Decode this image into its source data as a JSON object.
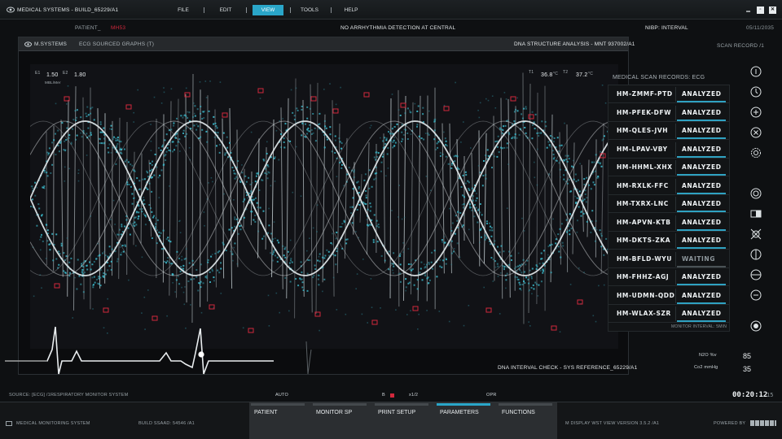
{
  "app": {
    "title": "MEDICAL SYSTEMS - BUILD_65229/A1"
  },
  "menu": {
    "items": [
      "FILE",
      "EDIT",
      "VIEW",
      "TOOLS",
      "HELP"
    ],
    "active": "VIEW"
  },
  "status": {
    "patient_label": "PATIENT_",
    "patient_value": "MH53",
    "center_message": "NO ARRHYTHMIA DETECTION AT CENTRAL",
    "nibp": "NIBP: INTERVAL",
    "date": "05/11/2035",
    "scan_record": "SCAN RECORD /1"
  },
  "monitor": {
    "brand": "M.SYSTEMS",
    "graph_source": "ECG SOURCED GRAPHS (T)",
    "analysis_title": "DNA STRUCTURE ANALYSIS - MNT 937002/A1",
    "readout_left": {
      "e1_label": "E1",
      "e1_value": "1.50",
      "e2_label": "E2",
      "e2_value": "1.80",
      "unit": "MBL/Mer"
    },
    "temp1": {
      "label": "T1",
      "value": "36.8",
      "unit": "°C"
    },
    "temp2": {
      "label": "T2",
      "value": "37.2",
      "unit": "°C"
    },
    "footer_text": "DNA INTERVAL CHECK - SYS REFERENCE_65229/A1"
  },
  "records": {
    "title": "MEDICAL SCAN RECORDS: ECG",
    "items": [
      {
        "id": "HM-ZMMF-PTD",
        "status": "ANALYZED"
      },
      {
        "id": "HM-PFEK-DFW",
        "status": "ANALYZED"
      },
      {
        "id": "HM-QLES-JVH",
        "status": "ANALYZED"
      },
      {
        "id": "HM-LPAV-VBY",
        "status": "ANALYZED"
      },
      {
        "id": "HM-HHML-XHX",
        "status": "ANALYZED"
      },
      {
        "id": "HM-RXLK-FFC",
        "status": "ANALYZED"
      },
      {
        "id": "HM-TXRX-LNC",
        "status": "ANALYZED"
      },
      {
        "id": "HM-APVN-KTB",
        "status": "ANALYZED"
      },
      {
        "id": "HM-DKTS-ZKA",
        "status": "ANALYZED"
      },
      {
        "id": "HM-BFLD-WYU",
        "status": "WAITING"
      },
      {
        "id": "HM-FHHZ-AGJ",
        "status": "ANALYZED"
      },
      {
        "id": "HM-UDMN-QDD",
        "status": "ANALYZED"
      },
      {
        "id": "HM-WLAX-SZR",
        "status": "ANALYZED"
      }
    ],
    "footer": "MONITOR INTERVAL: 5MIN"
  },
  "vitals": {
    "n2o_label": "N2O %v",
    "n2o_value": "85",
    "co2_label": "Co2 mmHg",
    "co2_value": "35"
  },
  "controls": {
    "source": "SOURCE: [ECG] /1",
    "respiratory": "RESPIRATORY MONITOR SYSTEM",
    "auto": "AUTO",
    "b_label": "B",
    "speed": "x1/2",
    "opr": "OPR",
    "timer": "00:20:12",
    "timer_frac": "15"
  },
  "footer": {
    "system": "MEDICAL MONITORING SYSTEM",
    "build": "BUILD SSAAD: 54546 /A1",
    "display": "M DISPLAY WST VIEW VERSION 3.5.2 /A1",
    "powered": "POWERED BY",
    "tabs": [
      "PATIENT",
      "MONITOR SP",
      "PRINT SETUP",
      "PARAMETERS",
      "FUNCTIONS"
    ],
    "active_tab": "PARAMETERS"
  },
  "colors": {
    "accent": "#2aa6c9",
    "alert": "#d1283c",
    "helix": "#3bb7c9"
  },
  "icons": [
    "eye-icon",
    "info-icon",
    "timer-icon",
    "add-icon",
    "cancel-icon",
    "settings-icon",
    "target-icon",
    "split-view-icon",
    "crossed-icon",
    "phase-icon",
    "theta-icon",
    "minus-icon",
    "record-icon"
  ]
}
